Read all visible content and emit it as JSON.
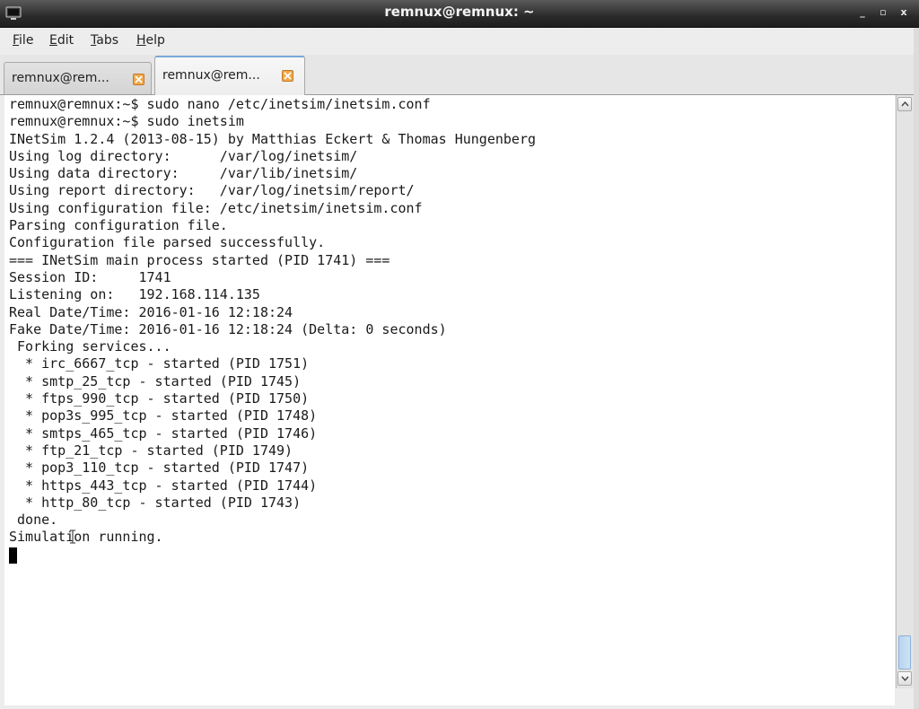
{
  "window": {
    "title": "remnux@remnux: ~",
    "controls": {
      "minimize": "_",
      "maximize": "▫",
      "close": "x"
    },
    "icon": "terminal-icon"
  },
  "menu": {
    "items": [
      {
        "label_key": "F",
        "label_rest": "ile"
      },
      {
        "label_key": "E",
        "label_rest": "dit"
      },
      {
        "label_key": "T",
        "label_rest": "abs"
      },
      {
        "label_key": "H",
        "label_rest": "elp"
      }
    ]
  },
  "tabs": [
    {
      "label": "remnux@rem...",
      "active": false,
      "close_icon": "close-icon"
    },
    {
      "label": "remnux@rem...",
      "active": true,
      "close_icon": "close-icon"
    }
  ],
  "terminal": {
    "lines": [
      "remnux@remnux:~$ sudo nano /etc/inetsim/inetsim.conf",
      "remnux@remnux:~$ sudo inetsim",
      "INetSim 1.2.4 (2013-08-15) by Matthias Eckert & Thomas Hungenberg",
      "Using log directory:      /var/log/inetsim/",
      "Using data directory:     /var/lib/inetsim/",
      "Using report directory:   /var/log/inetsim/report/",
      "Using configuration file: /etc/inetsim/inetsim.conf",
      "Parsing configuration file.",
      "Configuration file parsed successfully.",
      "=== INetSim main process started (PID 1741) ===",
      "Session ID:     1741",
      "Listening on:   192.168.114.135",
      "Real Date/Time: 2016-01-16 12:18:24",
      "Fake Date/Time: 2016-01-16 12:18:24 (Delta: 0 seconds)",
      " Forking services...",
      "  * irc_6667_tcp - started (PID 1751)",
      "  * smtp_25_tcp - started (PID 1745)",
      "  * ftps_990_tcp - started (PID 1750)",
      "  * pop3s_995_tcp - started (PID 1748)",
      "  * smtps_465_tcp - started (PID 1746)",
      "  * ftp_21_tcp - started (PID 1749)",
      "  * pop3_110_tcp - started (PID 1747)",
      "  * https_443_tcp - started (PID 1744)",
      "  * http_80_tcp - started (PID 1743)",
      " done.",
      "Simulation running."
    ]
  },
  "scrollbar": {
    "position_fraction": 1.0
  }
}
